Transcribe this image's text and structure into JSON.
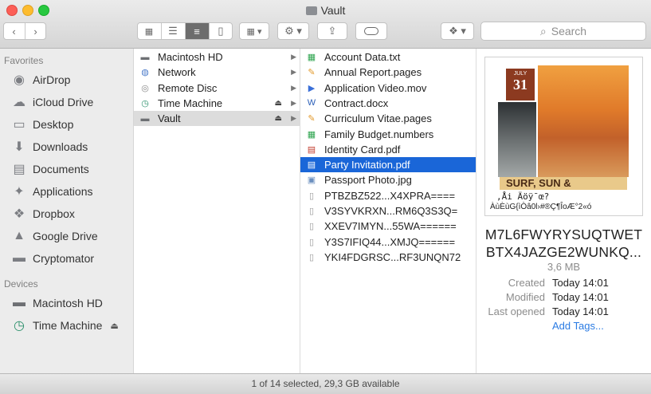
{
  "window": {
    "title": "Vault"
  },
  "toolbar": {
    "back_icon": "chevron-left",
    "forward_icon": "chevron-right",
    "view_icons": [
      "icon-view",
      "list-view",
      "column-view",
      "cover-flow-view"
    ],
    "active_view": "column-view",
    "search_placeholder": "Search"
  },
  "sidebar": {
    "favorites_header": "Favorites",
    "favorites": [
      {
        "label": "AirDrop",
        "icon": "airdrop-icon"
      },
      {
        "label": "iCloud Drive",
        "icon": "cloud-icon"
      },
      {
        "label": "Desktop",
        "icon": "desktop-icon"
      },
      {
        "label": "Downloads",
        "icon": "downloads-icon"
      },
      {
        "label": "Documents",
        "icon": "documents-icon"
      },
      {
        "label": "Applications",
        "icon": "applications-icon"
      },
      {
        "label": "Dropbox",
        "icon": "dropbox-icon"
      },
      {
        "label": "Google Drive",
        "icon": "google-drive-icon"
      },
      {
        "label": "Cryptomator",
        "icon": "folder-icon"
      }
    ],
    "devices_header": "Devices",
    "devices": [
      {
        "label": "Macintosh HD",
        "icon": "hard-drive-icon"
      },
      {
        "label": "Time Machine",
        "icon": "time-machine-icon",
        "eject": "⏏"
      }
    ]
  },
  "column1": [
    {
      "label": "Macintosh HD",
      "icon": "hard-drive-icon"
    },
    {
      "label": "Network",
      "icon": "network-icon"
    },
    {
      "label": "Remote Disc",
      "icon": "disc-icon"
    },
    {
      "label": "Time Machine",
      "icon": "time-machine-icon",
      "eject": "⏏"
    },
    {
      "label": "Vault",
      "icon": "drive-icon",
      "eject": "⏏"
    }
  ],
  "column2": [
    {
      "label": "Account Data.txt",
      "icon": "numbers-icon"
    },
    {
      "label": "Annual Report.pages",
      "icon": "pages-icon"
    },
    {
      "label": "Application Video.mov",
      "icon": "video-icon"
    },
    {
      "label": "Contract.docx",
      "icon": "word-icon"
    },
    {
      "label": "Curriculum Vitae.pages",
      "icon": "pages-icon"
    },
    {
      "label": "Family Budget.numbers",
      "icon": "numbers-icon"
    },
    {
      "label": "Identity Card.pdf",
      "icon": "pdf-icon"
    },
    {
      "label": "Party Invitation.pdf",
      "icon": "pdf-icon"
    },
    {
      "label": "Passport Photo.jpg",
      "icon": "image-icon"
    },
    {
      "label": "PTBZBZ522...X4XPRA====",
      "icon": "document-icon"
    },
    {
      "label": "V3SYVKRXN...RM6Q3S3Q=",
      "icon": "document-icon"
    },
    {
      "label": "XXEV7IMYN...55WA======",
      "icon": "document-icon"
    },
    {
      "label": "Y3S7IFIQ44...XMJQ======",
      "icon": "document-icon"
    },
    {
      "label": "YKI4FDGRSC...RF3UNQN72",
      "icon": "document-icon"
    }
  ],
  "preview": {
    "thumb_text": {
      "month": "JULY",
      "day": "31",
      "banner": "SURF, SUN &",
      "garble1": "‚Åi Äöÿ¯œ?",
      "garble2": "ÀùÈùG{ìÒâ0l›#®Ç¶ÎoÆ°2«ó"
    },
    "name_line1": "M7L6FWYRYSUQTWET",
    "name_line2": "BTX4JAZGE2WUNKQ...",
    "size": "3,6 MB",
    "created_label": "Created",
    "created_value": "Today 14:01",
    "modified_label": "Modified",
    "modified_value": "Today 14:01",
    "opened_label": "Last opened",
    "opened_value": "Today 14:01",
    "add_tags": "Add Tags..."
  },
  "status": {
    "text": "1 of 14 selected, 29,3 GB available"
  },
  "colors": {
    "selection": "#1a66d8",
    "sidebar_bg": "#ececec",
    "link": "#2a7be3"
  }
}
